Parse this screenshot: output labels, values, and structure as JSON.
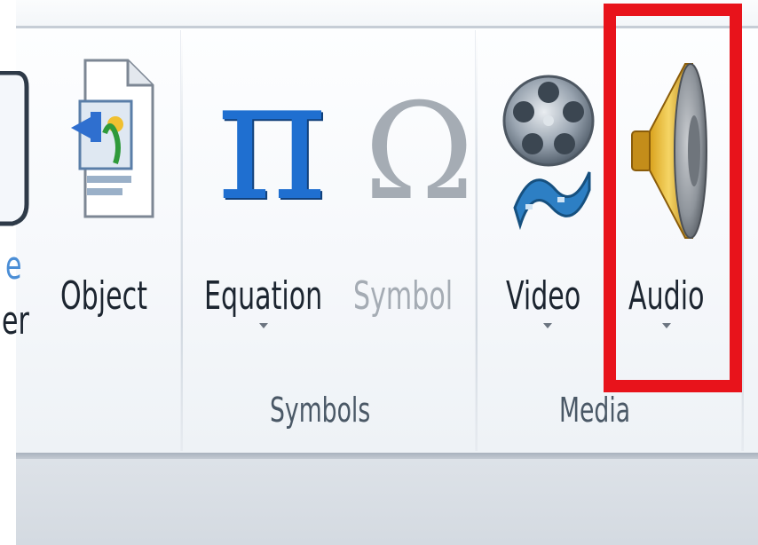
{
  "ribbon": {
    "partial_left": {
      "label_fragment_line1": "e",
      "label_fragment_line2": "er",
      "accent_color": "#4b8ed6"
    },
    "object": {
      "label": "Object",
      "icon": "object-icon"
    },
    "symbols_group": {
      "label": "Symbols",
      "equation": {
        "label": "Equation",
        "icon": "pi-icon",
        "icon_glyph": "π",
        "has_dropdown": true
      },
      "symbol": {
        "label": "Symbol",
        "icon": "omega-icon",
        "icon_glyph": "Ω",
        "disabled": true
      }
    },
    "media_group": {
      "label": "Media",
      "video": {
        "label": "Video",
        "icon": "film-reel-icon",
        "has_dropdown": true
      },
      "audio": {
        "label": "Audio",
        "icon": "speaker-icon",
        "has_dropdown": true,
        "highlighted": true
      }
    }
  },
  "colors": {
    "highlight": "#e8131b",
    "pi_blue": "#1f6fd0",
    "disabled_gray": "#a5acb4",
    "label_text": "#1c2530",
    "group_label_text": "#4a5866"
  }
}
